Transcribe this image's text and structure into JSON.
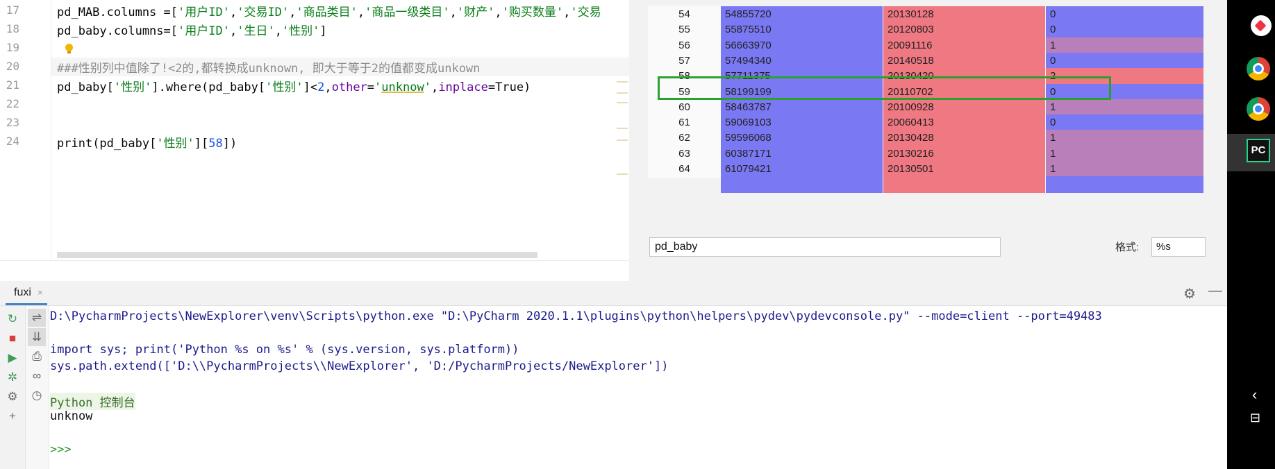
{
  "editor": {
    "lines": [
      {
        "num": "17",
        "tokens": [
          {
            "t": "pd_MAB.columns =[",
            "c": ""
          },
          {
            "t": "'用户ID'",
            "c": "s"
          },
          {
            "t": ",",
            "c": ""
          },
          {
            "t": "'交易ID'",
            "c": "s"
          },
          {
            "t": ",",
            "c": ""
          },
          {
            "t": "'商品类目'",
            "c": "s"
          },
          {
            "t": ",",
            "c": ""
          },
          {
            "t": "'商品一级类目'",
            "c": "s"
          },
          {
            "t": ",",
            "c": ""
          },
          {
            "t": "'财产'",
            "c": "s"
          },
          {
            "t": ",",
            "c": ""
          },
          {
            "t": "'购买数量'",
            "c": "s"
          },
          {
            "t": ",",
            "c": ""
          },
          {
            "t": "'交易",
            "c": "s"
          }
        ]
      },
      {
        "num": "18",
        "tokens": [
          {
            "t": "pd_baby.columns=[",
            "c": ""
          },
          {
            "t": "'用户ID'",
            "c": "s"
          },
          {
            "t": ",",
            "c": ""
          },
          {
            "t": "'生日'",
            "c": "s"
          },
          {
            "t": ",",
            "c": ""
          },
          {
            "t": "'性别'",
            "c": "s"
          },
          {
            "t": "]",
            "c": ""
          }
        ]
      },
      {
        "num": "19",
        "tokens": []
      },
      {
        "num": "20",
        "tokens": [
          {
            "t": "###性别列中值除了!<2的,都转换成unknown, 即大于等于2的值都变成unkown",
            "c": "c"
          }
        ]
      },
      {
        "num": "21",
        "tokens": [
          {
            "t": "pd_baby[",
            "c": ""
          },
          {
            "t": "'性别'",
            "c": "s"
          },
          {
            "t": "].where(pd_baby[",
            "c": ""
          },
          {
            "t": "'性别'",
            "c": "s"
          },
          {
            "t": "]<",
            "c": ""
          },
          {
            "t": "2",
            "c": "n"
          },
          {
            "t": ",",
            "c": ""
          },
          {
            "t": "other",
            "c": "p"
          },
          {
            "t": "=",
            "c": ""
          },
          {
            "t": "'",
            "c": "s"
          },
          {
            "t": "unknow",
            "c": "s under"
          },
          {
            "t": "'",
            "c": "s"
          },
          {
            "t": ",",
            "c": ""
          },
          {
            "t": "inplace",
            "c": "p"
          },
          {
            "t": "=True)",
            "c": ""
          }
        ]
      },
      {
        "num": "22",
        "tokens": []
      },
      {
        "num": "23",
        "tokens": []
      },
      {
        "num": "24",
        "tokens": [
          {
            "t": "print",
            "c": ""
          },
          {
            "t": "(pd_baby[",
            "c": ""
          },
          {
            "t": "'性别'",
            "c": "s"
          },
          {
            "t": "][",
            "c": ""
          },
          {
            "t": "58",
            "c": "n"
          },
          {
            "t": "])",
            "c": ""
          }
        ]
      }
    ]
  },
  "viewer": {
    "rows": [
      {
        "index": "54",
        "id": "54855720",
        "birthday": "20130128",
        "gender": "0"
      },
      {
        "index": "55",
        "id": "55875510",
        "birthday": "20120803",
        "gender": "0"
      },
      {
        "index": "56",
        "id": "56663970",
        "birthday": "20091116",
        "gender": "1"
      },
      {
        "index": "57",
        "id": "57494340",
        "birthday": "20140518",
        "gender": "0"
      },
      {
        "index": "58",
        "id": "57711375",
        "birthday": "20130420",
        "gender": "2"
      },
      {
        "index": "59",
        "id": "58199199",
        "birthday": "20110702",
        "gender": "0"
      },
      {
        "index": "60",
        "id": "58463787",
        "birthday": "20100928",
        "gender": "1"
      },
      {
        "index": "61",
        "id": "59069103",
        "birthday": "20060413",
        "gender": "0"
      },
      {
        "index": "62",
        "id": "59596068",
        "birthday": "20130428",
        "gender": "1"
      },
      {
        "index": "63",
        "id": "60387171",
        "birthday": "20130216",
        "gender": "1"
      },
      {
        "index": "64",
        "id": "61079421",
        "birthday": "20130501",
        "gender": "1"
      }
    ],
    "highlighted_index": "58",
    "colors": {
      "id_cell": "#7b78f4",
      "birthday_cell": "#f07882",
      "gender_0": "#7b78f4",
      "gender_1": "#b87fba",
      "gender_2": "#f07882",
      "selection_box": "#2ca02c"
    },
    "name_field": "pd_baby",
    "format_label": "格式:",
    "format_value": "%s"
  },
  "run": {
    "tab_label": "fuxi",
    "tab_close": "×",
    "settings_icon": "gear-icon",
    "minimize_icon": "minimize-icon",
    "console_lines": [
      {
        "text": "D:\\PycharmProjects\\NewExplorer\\venv\\Scripts\\python.exe \"D:\\PyCharm 2020.1.1\\plugins\\python\\helpers\\pydev\\pydevconsole.py\" --mode=client --port=49483",
        "color": "#1a1a8c"
      },
      {
        "text": "",
        "color": "#1a1a8c"
      },
      {
        "text": "import sys; print('Python %s on %s' % (sys.version, sys.platform))",
        "color": "#1a1a8c"
      },
      {
        "text": "sys.path.extend(['D:\\\\PycharmProjects\\\\NewExplorer', 'D:/PycharmProjects/NewExplorer'])",
        "color": "#1a1a8c"
      },
      {
        "text": "",
        "color": "#1a1a8c"
      },
      {
        "text": "Python 控制台",
        "color": "#3a6e2a"
      },
      {
        "text": "unknow",
        "color": "#111111"
      },
      {
        "text": "",
        "color": "#111111"
      },
      {
        "text": ">>>",
        "color": "#2e9a2e"
      }
    ],
    "toolbar_icons": [
      "rerun-icon",
      "stop-icon",
      "run-icon",
      "debug-icon",
      "settings-icon",
      "add-icon"
    ],
    "toolbar2_icons": [
      "soft-wrap-icon",
      "scroll-to-end-icon",
      "print-icon",
      "view-variables-icon",
      "history-icon"
    ]
  },
  "taskbar": {
    "icons": [
      "chrome-icon",
      "chrome-icon",
      "pycharm-icon"
    ],
    "pycharm_label": "PC",
    "tray": [
      "chevron-left-icon",
      "network-icon"
    ]
  }
}
